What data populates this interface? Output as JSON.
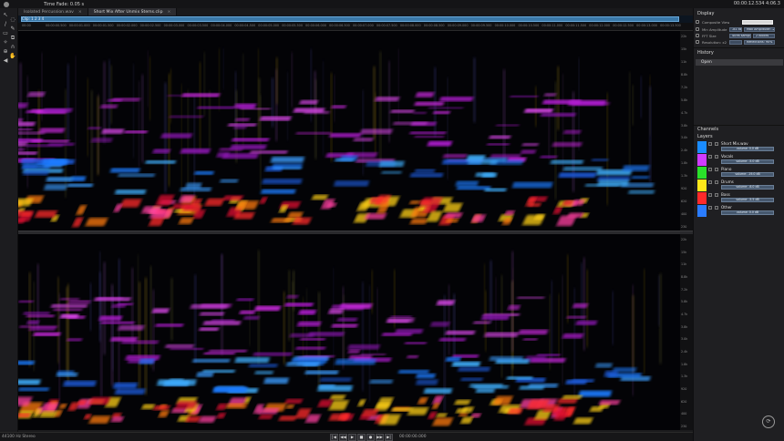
{
  "topbar": {
    "fade_label": "Time Fade: 0.05 s",
    "time_readout": "00:00:12.534   4:06.3"
  },
  "tabs": [
    {
      "label": "Isolated Percussion.wav",
      "close": "×"
    },
    {
      "label": "Short Mix After Unmix Stems.clip",
      "close": "×"
    }
  ],
  "overview": {
    "label": "Clip: 1 2 3 4",
    "accent": "#3a78a8"
  },
  "ruler": [
    "00:00",
    "00:00:00.500",
    "00:00:01.000",
    "00:00:01.500",
    "00:00:02.000",
    "00:00:02.500",
    "00:00:03.000",
    "00:00:03.500",
    "00:00:04.000",
    "00:00:04.500",
    "00:00:05.000",
    "00:00:05.500",
    "00:00:06.000",
    "00:00:06.500",
    "00:00:07.000",
    "00:00:07.500",
    "00:00:08.000",
    "00:00:08.500",
    "00:00:09.000",
    "00:00:09.500",
    "00:00:10.000",
    "00:00:10.500",
    "00:00:11.000",
    "00:00:11.500",
    "00:00:12.000",
    "00:00:12.500",
    "00:00:13.000",
    "00:00:13.500"
  ],
  "tools": [
    "select-icon",
    "lasso-icon",
    "pencil-icon",
    "brush-icon",
    "eraser-icon",
    "stamp-icon",
    "wand-icon",
    "magnet-icon",
    "zoom-icon",
    "hand-icon",
    "speaker-icon"
  ],
  "tool_glyphs": [
    "↖",
    "◌",
    "/",
    "✎",
    "▭",
    "⧉",
    "✧",
    "∩",
    "⊕",
    "✋",
    "◀"
  ],
  "freq_labels": [
    "22k",
    "15k",
    "11k",
    "8.8k",
    "7.2k",
    "5.8k",
    "4.7k",
    "3.8k",
    "3.0k",
    "2.4k",
    "1.8k",
    "1.3k",
    "920",
    "620",
    "400",
    "230"
  ],
  "display": {
    "title": "Display",
    "rows": [
      {
        "label": "Composite View",
        "values": [
          "",
          ""
        ]
      },
      {
        "label": "Min Amplitude",
        "values": [
          "-81 dB",
          "Max Amplitude: -24 dB"
        ]
      },
      {
        "label": "FFT Size",
        "values": [
          "4096 samples",
          "2 Blocks"
        ]
      },
      {
        "label": "Resolution: x2",
        "values": [
          "",
          "Reflections: 90%"
        ]
      }
    ]
  },
  "history": {
    "title": "History",
    "item": "Open"
  },
  "channels": {
    "title": "Channels",
    "subtitle": "Layers"
  },
  "layers": [
    {
      "name": "Short Mix.wav",
      "volume": "volume: 0.0 dB",
      "color": "#1a8cff"
    },
    {
      "name": "Vocals",
      "volume": "volume: -5.0 dB",
      "color": "#d03cff"
    },
    {
      "name": "Piano",
      "volume": "volume: -19.0 dB",
      "color": "#2ae02a"
    },
    {
      "name": "Drums",
      "volume": "volume: -6.0 dB",
      "color": "#ffe81a"
    },
    {
      "name": "Bass",
      "volume": "volume: -5.5 dB",
      "color": "#ff2a2a"
    },
    {
      "name": "Other",
      "volume": "volume: 0.0 dB",
      "color": "#2a7cff"
    }
  ],
  "status": {
    "format": "44100 Hz Stereo",
    "transport_time": "00:00:00.000"
  },
  "transport": [
    "|◀",
    "◀◀",
    "▶",
    "■",
    "●",
    "▶▶",
    "▶|"
  ],
  "logo": "⟳"
}
